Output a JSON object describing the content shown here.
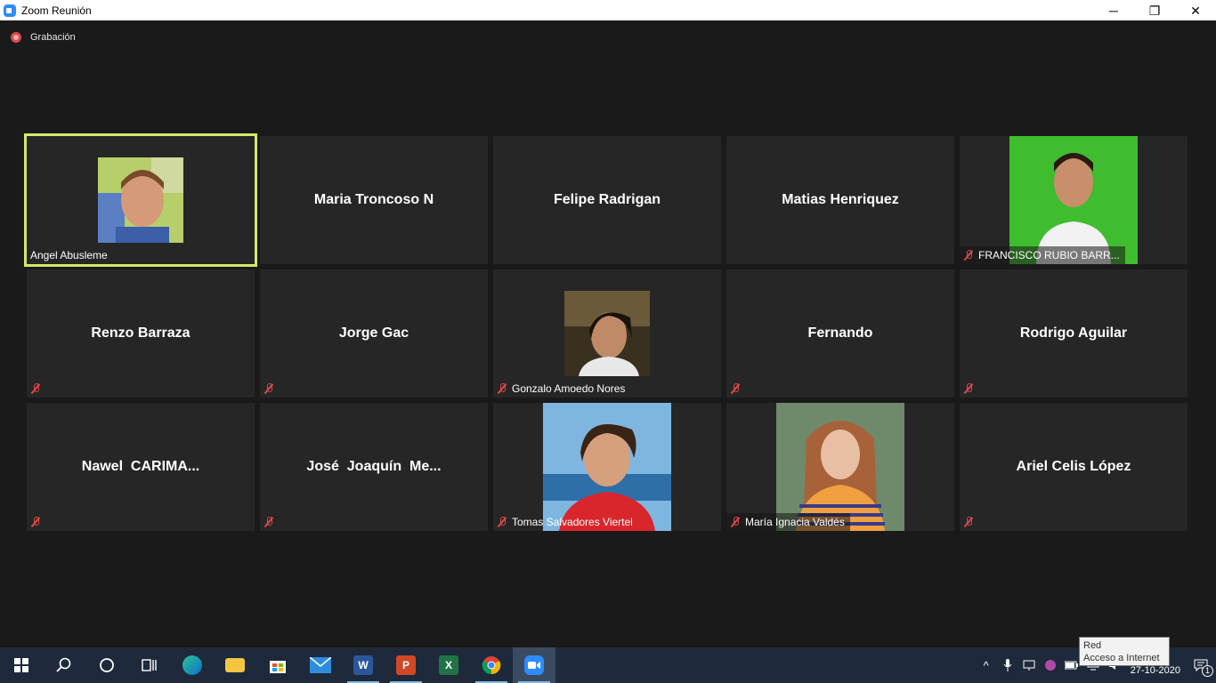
{
  "window": {
    "title": "Zoom Reunión",
    "minimize": "─",
    "restore": "❐",
    "close": "✕"
  },
  "recording": {
    "label": "Grabación"
  },
  "participants": [
    {
      "name": "Angel Abusleme",
      "video": true,
      "muted": false,
      "active": true
    },
    {
      "name": "Maria Troncoso N",
      "video": false,
      "muted": false
    },
    {
      "name": "Felipe Radrigan",
      "video": false,
      "muted": false
    },
    {
      "name": "Matias Henriquez",
      "video": false,
      "muted": false
    },
    {
      "name": "FRANCISCO RUBIO BARR...",
      "video": true,
      "muted": true
    },
    {
      "name": "Renzo Barraza",
      "video": false,
      "muted": true
    },
    {
      "name": "Jorge Gac",
      "video": false,
      "muted": true
    },
    {
      "name": "Gonzalo Amoedo Nores",
      "video": true,
      "muted": true
    },
    {
      "name": "Fernando",
      "video": false,
      "muted": true
    },
    {
      "name": "Rodrigo Aguilar",
      "video": false,
      "muted": true
    },
    {
      "name": "Nawel  CARIMA...",
      "video": false,
      "muted": true
    },
    {
      "name": "José  Joaquín  Me...",
      "video": false,
      "muted": true
    },
    {
      "name": "Tomas Salvadores Viertel",
      "video": true,
      "muted": true
    },
    {
      "name": "María Ignacia Valdés",
      "video": true,
      "muted": true
    },
    {
      "name": "Ariel Celis López",
      "video": false,
      "muted": true
    }
  ],
  "taskbar": {
    "apps": [
      "start",
      "search",
      "cortana",
      "task-view",
      "edge",
      "file-explorer",
      "store",
      "mail",
      "word",
      "powerpoint",
      "excel",
      "chrome",
      "zoom"
    ],
    "word_letter": "W",
    "ppt_letter": "P",
    "excel_letter": "X"
  },
  "tray": {
    "date": "27-10-2020",
    "notification_count": "1"
  },
  "tooltip": {
    "line1": "Red",
    "line2": "Acceso a Internet"
  },
  "colors": {
    "active_speaker": "#d6e86a",
    "mute_red": "#e0484c",
    "zoom_blue": "#2d8cff"
  }
}
